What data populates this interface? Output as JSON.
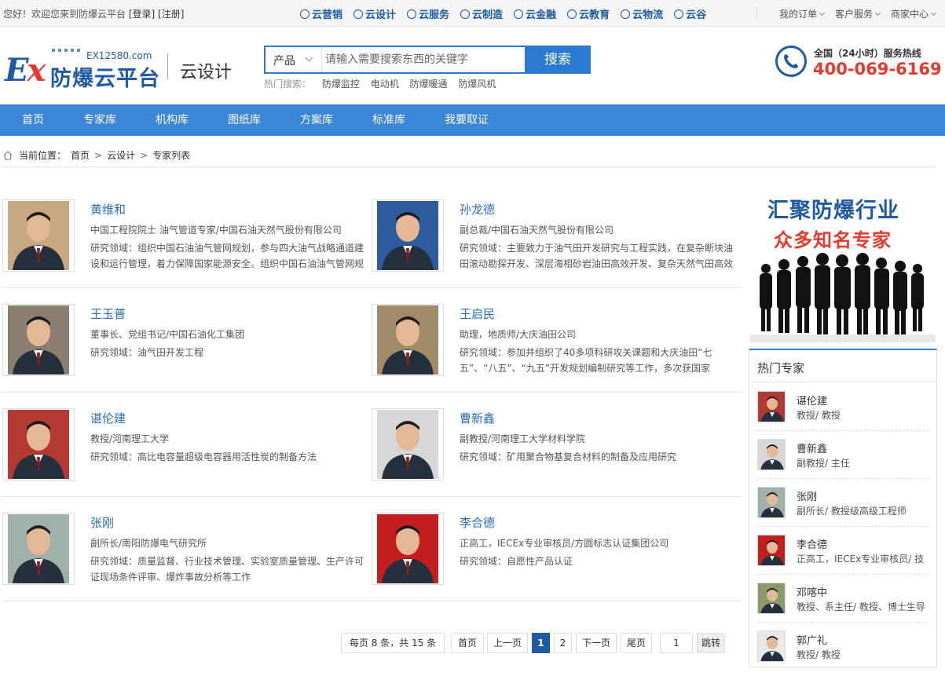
{
  "topbar": {
    "welcome": "您好！欢迎您来到防爆云平台",
    "login": "[登录]",
    "register": "[注册]",
    "cloud_links": [
      "云营销",
      "云设计",
      "云服务",
      "云制造",
      "云金融",
      "云教育",
      "云物流",
      "云谷"
    ],
    "my_orders": "我的订单",
    "customer_service": "客户服务",
    "merchant_center": "商家中心"
  },
  "header": {
    "logo_ex": "EX",
    "logo_brand": "防爆云平台",
    "logo_domain": "EX12580.com",
    "subtitle": "云设计",
    "search_category": "产品",
    "search_placeholder": "请输入需要搜索东西的关键字",
    "search_button": "搜索",
    "hot_label": "热门搜索：",
    "hot_keywords": [
      "防爆监控",
      "电动机",
      "防爆暖通",
      "防爆风机"
    ],
    "hotline_label": "全国（24小时）服务热线",
    "hotline_number": "400-069-6169"
  },
  "nav": [
    "首页",
    "专家库",
    "机构库",
    "图纸库",
    "方案库",
    "标准库",
    "我要取证"
  ],
  "breadcrumb": {
    "label": "当前位置：",
    "items": [
      "首页",
      "云设计",
      "专家列表"
    ]
  },
  "experts": [
    {
      "name": "黄维和",
      "title": "中国工程院院士 油气管道专家/中国石油天然气股份有限公司",
      "field": "研究领域：组织中国石油油气管网规划，参与四大油气战略通道建设和运行管理，着力保障国家能源安全。组织中国石油油气管网规",
      "photo_bg": "#c8a882"
    },
    {
      "name": "孙龙德",
      "title": "副总裁/中国石油天然气股份有限公司",
      "field": "研究领域：主要致力于油气田开发研究与工程实践，在复杂断块油田滚动勘探开发、深层海相砂岩油田高效开发、复杂天然气田高效",
      "photo_bg": "#2d5d9e"
    },
    {
      "name": "王玉普",
      "title": "董事长、党组书记/中国石油化工集团",
      "field": "研究领域：油气田开发工程",
      "photo_bg": "#8a7f70"
    },
    {
      "name": "王启民",
      "title": "助理，地质师/大庆油田公司",
      "field": "研究领域：参加并组织了40多项科研攻关课题和大庆油田“七五”、“八五”、“九五”开发规划编制研究等工作，多次获国家",
      "photo_bg": "#a08a68"
    },
    {
      "name": "谌伦建",
      "title": "教授/河南理工大学",
      "field": "研究领域：高比电容量超级电容器用活性炭的制备方法",
      "photo_bg": "#b23a32"
    },
    {
      "name": "曹新鑫",
      "title": "副教授/河南理工大学材料学院",
      "field": "研究领域：矿用聚合物基复合材料的制备及应用研究",
      "photo_bg": "#d7d7d7"
    },
    {
      "name": "张刚",
      "title": "副所长/南阳防爆电气研究所",
      "field": "研究领域：质量监督、行业技术管理、实验室质量管理、生产许可证现场条件评审、爆炸事故分析等工作",
      "photo_bg": "#9fb0a8"
    },
    {
      "name": "李合德",
      "title": "正高工，IECEx专业审核员/方圆标志认证集团公司",
      "field": "研究领域：自愿性产品认证",
      "photo_bg": "#c41f1f"
    }
  ],
  "pagination": {
    "summary": "每页 8 条，共 15 条",
    "first": "首页",
    "prev": "上一页",
    "pages": [
      "1",
      "2"
    ],
    "current": "1",
    "next": "下一页",
    "last": "尾页",
    "jump_value": "1",
    "jump_button": "跳转"
  },
  "sidebar": {
    "banner_line1": "汇聚防爆行业",
    "banner_line2": "众多知名专家",
    "hot_title": "热门专家",
    "hot_experts": [
      {
        "name": "谌伦建",
        "title": "教授/ 教授",
        "photo_bg": "#b23a32"
      },
      {
        "name": "曹新鑫",
        "title": "副教授/ 主任",
        "photo_bg": "#d7d7d7"
      },
      {
        "name": "张刚",
        "title": "副所长/ 教授级高级工程师",
        "photo_bg": "#9fb0a8"
      },
      {
        "name": "李合德",
        "title": "正高工，IECEx专业审核员/ 技",
        "photo_bg": "#c41f1f"
      },
      {
        "name": "邓喀中",
        "title": "教授、系主任/ 教授、博士生导",
        "photo_bg": "#8c9a6a"
      },
      {
        "name": "郭广礼",
        "title": "教授/ 教授",
        "photo_bg": "#e9e9e9"
      }
    ]
  },
  "colors": {
    "accent": "#3b86d6",
    "brand_blue": "#1f5aa6",
    "brand_red": "#e63a2e"
  }
}
